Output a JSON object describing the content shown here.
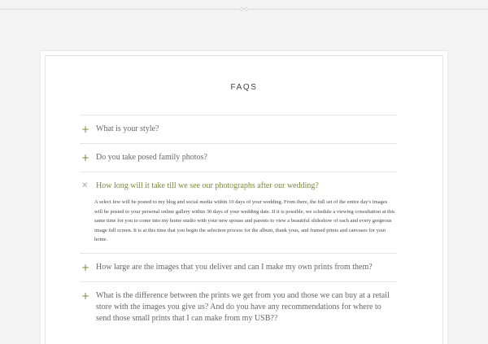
{
  "header": {
    "ornament_icon": "diamond-ornament-icon",
    "ornament_glyph": "◇◇"
  },
  "faq": {
    "title": "FAQS",
    "accent_color": "#7a8a3a",
    "items": [
      {
        "icon": "plus-icon",
        "icon_glyph": "+",
        "question": "What is your style?",
        "expanded": false
      },
      {
        "icon": "plus-icon",
        "icon_glyph": "+",
        "question": "Do you take posed family photos?",
        "expanded": false
      },
      {
        "icon": "close-icon",
        "icon_glyph": "✕",
        "question": "How long will it take till we see our photographs after our wedding?",
        "expanded": true,
        "answer": "A select few will be posted to my blog and social media within 10 days of your wedding. From there, the full set of the entire day's images will be posted to your personal online gallery within 30 days of your wedding date. If it is possible, we schedule a viewing consultation at this same time for you to come into my home studio with your new spouse and parents to view a beautiful slideshow of each and every gorgeous image full screen. It is at this time that you begin the selection process for the album, thank yous, and framed prints and canvases for your home."
      },
      {
        "icon": "plus-icon",
        "icon_glyph": "+",
        "question": "How large are the images that you deliver and can I make my own prints from them?",
        "expanded": false
      },
      {
        "icon": "plus-icon",
        "icon_glyph": "+",
        "question": "What is the difference between the prints we get from you and those we can buy at a retail store with the images you give us? And do you have any recommendations for where to send those small prints that I can make from my USB??",
        "expanded": false
      }
    ]
  }
}
